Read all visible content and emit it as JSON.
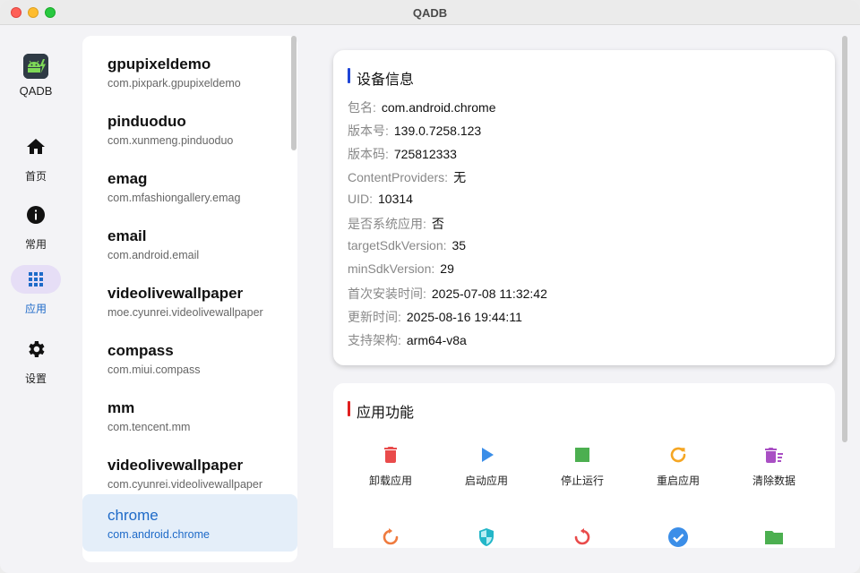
{
  "window": {
    "title": "QADB"
  },
  "rail": {
    "logo_text": "QADB",
    "items": [
      {
        "label": "首页",
        "icon": "home-icon"
      },
      {
        "label": "常用",
        "icon": "info-icon"
      },
      {
        "label": "应用",
        "icon": "apps-icon",
        "active": true
      },
      {
        "label": "设置",
        "icon": "gear-icon"
      }
    ]
  },
  "apps": [
    {
      "name": "gpupixeldemo",
      "package": "com.pixpark.gpupixeldemo"
    },
    {
      "name": "pinduoduo",
      "package": "com.xunmeng.pinduoduo"
    },
    {
      "name": "emag",
      "package": "com.mfashiongallery.emag"
    },
    {
      "name": "email",
      "package": "com.android.email"
    },
    {
      "name": "videolivewallpaper",
      "package": "moe.cyunrei.videolivewallpaper"
    },
    {
      "name": "compass",
      "package": "com.miui.compass"
    },
    {
      "name": "mm",
      "package": "com.tencent.mm"
    },
    {
      "name": "videolivewallpaper",
      "package": "com.cyunrei.videolivewallpaper"
    },
    {
      "name": "chrome",
      "package": "com.android.chrome",
      "selected": true
    }
  ],
  "device_info": {
    "title": "设备信息",
    "rows": [
      {
        "label": "包名:",
        "value": "com.android.chrome"
      },
      {
        "label": "版本号:",
        "value": "139.0.7258.123"
      },
      {
        "label": "版本码:",
        "value": "725812333"
      },
      {
        "label": "ContentProviders:",
        "value": "无"
      },
      {
        "label": "UID:",
        "value": "10314"
      },
      {
        "label": "是否系统应用:",
        "value": "否"
      },
      {
        "label": "targetSdkVersion:",
        "value": "35"
      },
      {
        "label": "minSdkVersion:",
        "value": "29"
      },
      {
        "label": "首次安装时间:",
        "value": "2025-07-08 11:32:42"
      },
      {
        "label": "更新时间:",
        "value": "2025-08-16 19:44:11"
      },
      {
        "label": "支持架构:",
        "value": "arm64-v8a"
      }
    ]
  },
  "app_functions": {
    "title": "应用功能",
    "buttons": [
      {
        "label": "卸载应用",
        "icon": "trash-icon",
        "color": "#e94b4b"
      },
      {
        "label": "启动应用",
        "icon": "play-icon",
        "color": "#3b8ee8"
      },
      {
        "label": "停止运行",
        "icon": "stop-icon",
        "color": "#4caf50"
      },
      {
        "label": "重启应用",
        "icon": "restart-icon",
        "color": "#f5a623"
      },
      {
        "label": "清除数据",
        "icon": "clear-data-icon",
        "color": "#a94fc4"
      }
    ],
    "partial_icons": [
      {
        "icon": "refresh-icon",
        "color": "#ef7b3f"
      },
      {
        "icon": "shield-icon",
        "color": "#22b6c8"
      },
      {
        "icon": "reset-icon",
        "color": "#e94b4b"
      },
      {
        "icon": "check-circle-icon",
        "color": "#3b8ee8"
      },
      {
        "icon": "folder-icon",
        "color": "#4caf50"
      }
    ]
  },
  "colors": {
    "accent": "#1e6ac8",
    "active_nav": "#e6def6",
    "selected_row": "#e4eef9",
    "info_bar": "#1f45d6",
    "func_bar": "#e02020"
  }
}
